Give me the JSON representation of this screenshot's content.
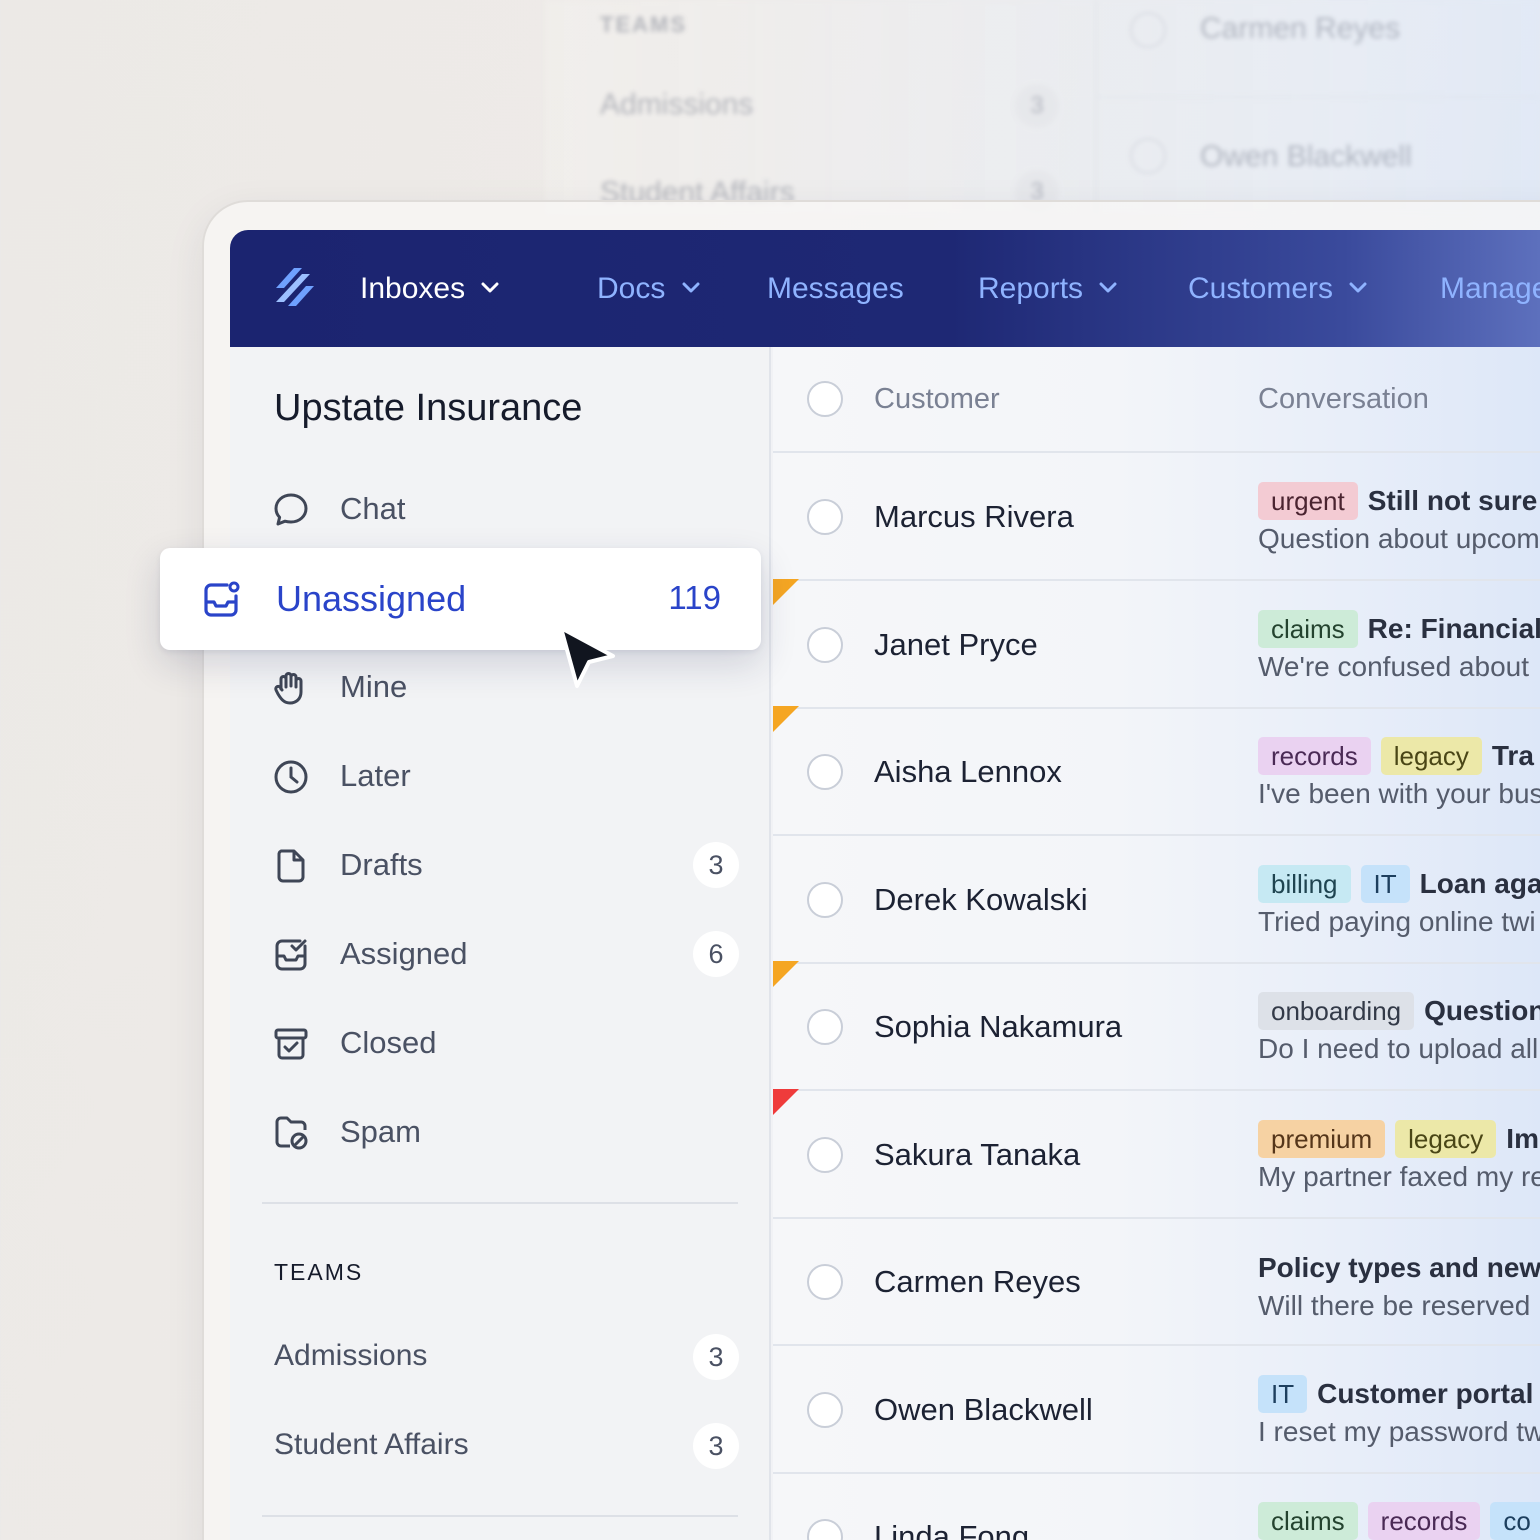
{
  "background": {
    "teams_label": "TEAMS",
    "teams": [
      {
        "label": "Admissions",
        "count": "3"
      },
      {
        "label": "Student Affairs",
        "count": "3"
      }
    ],
    "customers": [
      "Carmen Reyes",
      "Owen Blackwell"
    ]
  },
  "nav": {
    "logo": "help-scout-logo",
    "items": [
      {
        "label": "Inboxes",
        "dropdown": true
      },
      {
        "label": "Docs",
        "dropdown": true
      },
      {
        "label": "Messages",
        "dropdown": false
      },
      {
        "label": "Reports",
        "dropdown": true
      },
      {
        "label": "Customers",
        "dropdown": true
      },
      {
        "label": "Manage",
        "dropdown": false
      }
    ]
  },
  "sidebar": {
    "title": "Upstate Insurance",
    "items": [
      {
        "label": "Chat",
        "icon": "chat-bubble-icon",
        "count": ""
      },
      {
        "label": "Unassigned",
        "icon": "inbox-icon",
        "count": "119",
        "active": true
      },
      {
        "label": "Mine",
        "icon": "hand-icon",
        "count": ""
      },
      {
        "label": "Later",
        "icon": "clock-icon",
        "count": ""
      },
      {
        "label": "Drafts",
        "icon": "draft-icon",
        "count": "3"
      },
      {
        "label": "Assigned",
        "icon": "assigned-icon",
        "count": "6"
      },
      {
        "label": "Closed",
        "icon": "archive-icon",
        "count": ""
      },
      {
        "label": "Spam",
        "icon": "spam-icon",
        "count": ""
      }
    ],
    "teams_label": "TEAMS",
    "teams": [
      {
        "label": "Admissions",
        "count": "3"
      },
      {
        "label": "Student Affairs",
        "count": "3"
      }
    ]
  },
  "list": {
    "headers": {
      "customer": "Customer",
      "conversation": "Conversation"
    },
    "rows": [
      {
        "name": "Marcus Rivera",
        "flag": "",
        "tags": [
          {
            "text": "urgent",
            "bg": "#f3cbd3",
            "fg": "#4a2430"
          }
        ],
        "subject": "Still not sure",
        "preview": "Question about upcom"
      },
      {
        "name": "Janet Pryce",
        "flag": "#f5a623",
        "tags": [
          {
            "text": "claims",
            "bg": "#cdebd8",
            "fg": "#24432f"
          }
        ],
        "subject": "Re: Financial",
        "preview": "We're confused about"
      },
      {
        "name": "Aisha Lennox",
        "flag": "#f5a623",
        "tags": [
          {
            "text": "records",
            "bg": "#ead2f1",
            "fg": "#4a2a55"
          },
          {
            "text": "legacy",
            "bg": "#ece8a8",
            "fg": "#4a4616"
          }
        ],
        "subject": "Tra",
        "preview": "I've been with your bus"
      },
      {
        "name": "Derek Kowalski",
        "flag": "",
        "tags": [
          {
            "text": "billing",
            "bg": "#c6e9f3",
            "fg": "#1f4450"
          },
          {
            "text": "IT",
            "bg": "#c5e2fa",
            "fg": "#1d3f5e"
          }
        ],
        "subject": "Loan aga",
        "preview": "Tried paying online twi"
      },
      {
        "name": "Sophia Nakamura",
        "flag": "#f5a623",
        "tags": [
          {
            "text": "onboarding",
            "bg": "#dde1e8",
            "fg": "#333a48"
          }
        ],
        "subject": "Question",
        "preview": "Do I need to upload all"
      },
      {
        "name": "Sakura Tanaka",
        "flag": "#ef3b3b",
        "tags": [
          {
            "text": "premium",
            "bg": "#f6d2a3",
            "fg": "#55361a"
          },
          {
            "text": "legacy",
            "bg": "#ece8a8",
            "fg": "#4a4616"
          }
        ],
        "subject": "Im",
        "preview": "My partner faxed my re"
      },
      {
        "name": "Carmen Reyes",
        "flag": "",
        "tags": [],
        "subject": "Policy types and new",
        "preview": "Will there be reserved"
      },
      {
        "name": "Owen Blackwell",
        "flag": "",
        "tags": [
          {
            "text": "IT",
            "bg": "#c5e2fa",
            "fg": "#1d3f5e"
          }
        ],
        "subject": "Customer portal",
        "preview": "I reset my password tw"
      },
      {
        "name": "Linda Fong",
        "flag": "",
        "tags": [
          {
            "text": "claims",
            "bg": "#cdebd8",
            "fg": "#24432f"
          },
          {
            "text": "records",
            "bg": "#ead2f1",
            "fg": "#4a2a55"
          },
          {
            "text": "co",
            "bg": "#c5e2fa",
            "fg": "#1d3f5e"
          }
        ],
        "subject": "",
        "preview": ""
      }
    ]
  }
}
